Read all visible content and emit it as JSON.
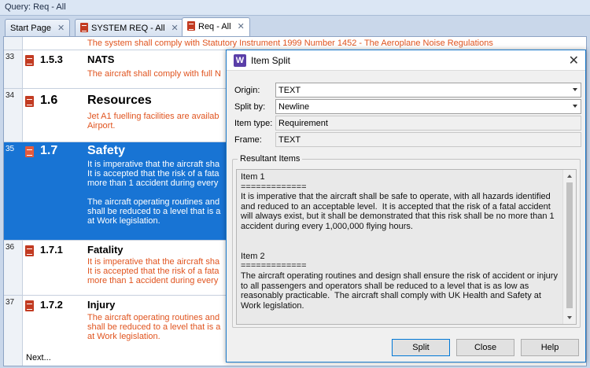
{
  "window": {
    "title": "Query: Req - All"
  },
  "tabs": [
    {
      "label": "Start Page",
      "close": "✕"
    },
    {
      "label": "SYSTEM REQ - All",
      "close": "✕"
    },
    {
      "label": "Req - All",
      "close": "✕"
    }
  ],
  "rows": [
    {
      "text": "The system shall comply with Statutory Instrument 1999 Number 1452 - The Aeroplane Noise Regulations"
    },
    {
      "num": "33",
      "item": "1.5.3",
      "heading": "NATS",
      "text": "The aircraft shall comply with full N"
    },
    {
      "num": "34",
      "item": "1.6",
      "heading": "Resources",
      "text": "Jet A1 fuelling facilities are availab\nAirport."
    },
    {
      "num": "35",
      "item": "1.7",
      "heading": "Safety",
      "text": "It is imperative that the aircraft sha\nIt is accepted that the risk of a fata\nmore than 1 accident during every\n\nThe aircraft operating routines and\nshall be reduced to a level that is a\nat Work legislation."
    },
    {
      "num": "36",
      "item": "1.7.1",
      "heading": "Fatality",
      "text": "It is imperative that the aircraft sha\nIt is accepted that the risk of a fata\nmore than 1 accident during every"
    },
    {
      "num": "37",
      "item": "1.7.2",
      "heading": "Injury",
      "text": "The aircraft operating routines and\nshall be reduced to a level that is a\nat Work legislation."
    }
  ],
  "next_label": "Next...",
  "dialog": {
    "title": "Item Split",
    "icon_letter": "W",
    "close": "✕",
    "origin_label": "Origin:",
    "origin_value": "TEXT",
    "split_label": "Split by:",
    "split_value": "Newline",
    "type_label": "Item type:",
    "type_value": "Requirement",
    "frame_label": "Frame:",
    "frame_value": "TEXT",
    "group_label": "Resultant Items",
    "result_text": "Item 1\n=============\nIt is imperative that the aircraft shall be safe to operate, with all hazards identified and reduced to an acceptable level.  It is accepted that the risk of a fatal accident will always exist, but it shall be demonstrated that this risk shall be no more than 1 accident during every 1,000,000 flying hours.\n\n\nItem 2\n=============\nThe aircraft operating routines and design shall ensure the risk of accident or injury to all passengers and operators shall be reduced to a level that is as low as reasonably practicable.  The aircraft shall comply with UK Health and Safety at Work legislation.",
    "split_btn": "Split",
    "close_btn": "Close",
    "help_btn": "Help"
  },
  "colors": {
    "accent": "#1874d4",
    "requirement_text": "#e0541f",
    "doc_icon": "#c23b22"
  }
}
